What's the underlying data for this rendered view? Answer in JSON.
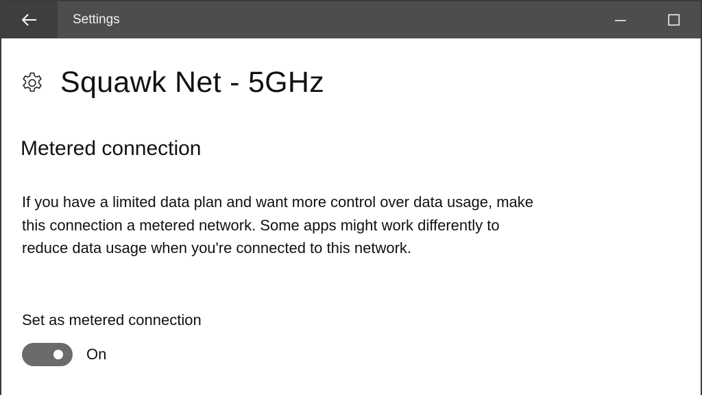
{
  "window": {
    "title": "Settings",
    "back_icon": "back-arrow-icon",
    "minimize_icon": "minimize-icon",
    "maximize_icon": "maximize-icon"
  },
  "page": {
    "icon": "gear-icon",
    "title": "Squawk Net - 5GHz"
  },
  "metered": {
    "section_title": "Metered connection",
    "description": "If you have a limited data plan and want more control over data usage, make this connection a metered network. Some apps might work differently to reduce data usage when you're connected to this network.",
    "toggle_label": "Set as metered connection",
    "toggle_state": "On",
    "toggle_on": true
  },
  "colors": {
    "titlebar": "#4d4d4d",
    "back_button": "#3e3e3e",
    "toggle_track": "#6b6b6b"
  }
}
